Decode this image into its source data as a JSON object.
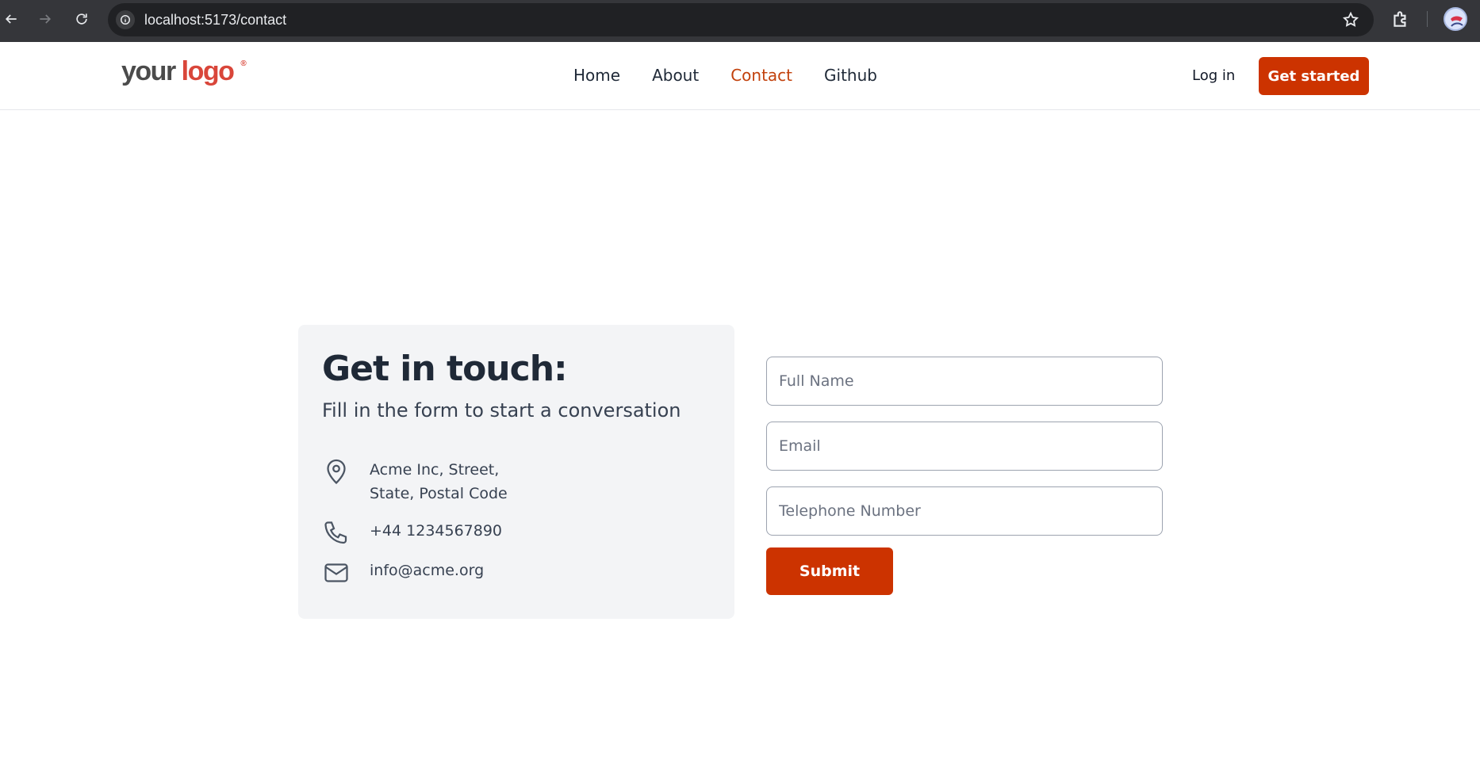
{
  "browser": {
    "url": "localhost:5173/contact"
  },
  "header": {
    "logo_your": "your",
    "logo_word": "logo",
    "logo_mark": "®",
    "nav": [
      {
        "label": "Home",
        "active": false
      },
      {
        "label": "About",
        "active": false
      },
      {
        "label": "Contact",
        "active": true
      },
      {
        "label": "Github",
        "active": false
      }
    ],
    "login_label": "Log in",
    "cta_label": "Get started"
  },
  "contact": {
    "title": "Get in touch:",
    "subtitle": "Fill in the form to start a conversation",
    "address_line1": "Acme Inc, Street,",
    "address_line2": "State, Postal Code",
    "phone": "+44 1234567890",
    "email": "info@acme.org"
  },
  "form": {
    "name_placeholder": "Full Name",
    "email_placeholder": "Email",
    "phone_placeholder": "Telephone Number",
    "submit_label": "Submit"
  },
  "colors": {
    "accent": "#cc3300",
    "active_nav": "#c2410c",
    "card_bg": "#f3f4f6"
  },
  "icons": {
    "address": "map-pin-icon",
    "phone": "phone-icon",
    "email": "mail-icon"
  }
}
